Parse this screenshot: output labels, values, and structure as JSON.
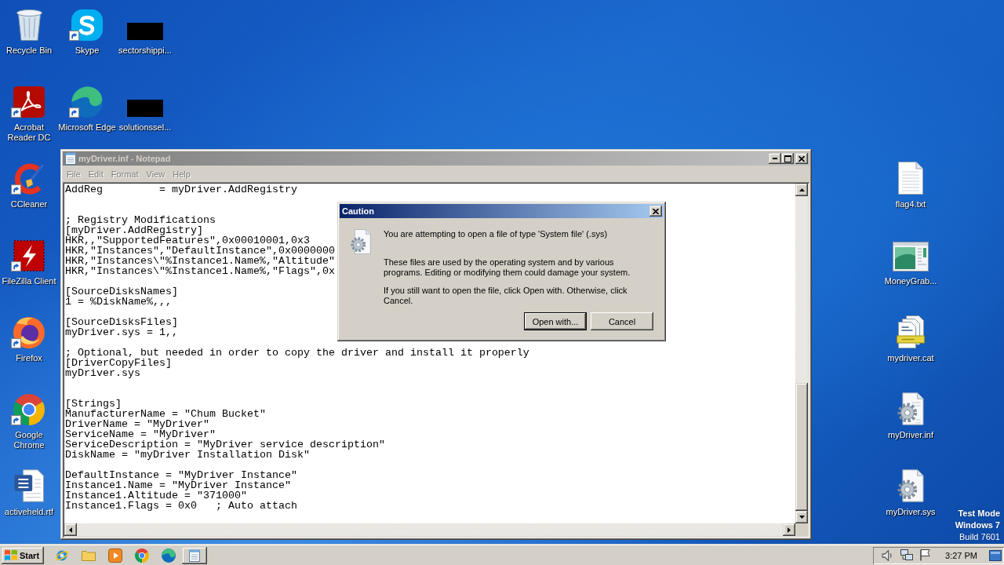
{
  "desktop": {
    "icon_columns": [
      {
        "icons": [
          {
            "label": "Recycle Bin",
            "kind": "recycle_bin",
            "shortcut": false
          },
          {
            "label": "Acrobat Reader DC",
            "kind": "acrobat",
            "shortcut": true
          },
          {
            "label": "CCleaner",
            "kind": "ccleaner",
            "shortcut": true
          },
          {
            "label": "FileZilla Client",
            "kind": "filezilla",
            "shortcut": true
          },
          {
            "label": "Firefox",
            "kind": "firefox",
            "shortcut": true
          },
          {
            "label": "Google Chrome",
            "kind": "chrome",
            "shortcut": true
          },
          {
            "label": "activeheld.rtf",
            "kind": "word_doc",
            "shortcut": false
          }
        ]
      },
      {
        "icons": [
          {
            "label": "Skype",
            "kind": "skype",
            "shortcut": true
          },
          {
            "label": "Microsoft Edge",
            "kind": "edge",
            "shortcut": true
          }
        ]
      },
      {
        "icons": [
          {
            "label": "sectorshippi...",
            "kind": "redacted",
            "shortcut": false
          },
          {
            "label": "solutionssel...",
            "kind": "redacted",
            "shortcut": false
          }
        ]
      }
    ],
    "right_icons": [
      {
        "label": "flag4.txt",
        "kind": "text_file",
        "shortcut": false
      },
      {
        "label": "MoneyGrab...",
        "kind": "app_window",
        "shortcut": false
      },
      {
        "label": "mydriver.cat",
        "kind": "catalog",
        "shortcut": false
      },
      {
        "label": "myDriver.inf",
        "kind": "setup_info",
        "shortcut": false
      },
      {
        "label": "myDriver.sys",
        "kind": "system_file",
        "shortcut": false
      }
    ],
    "test_mode_notice": [
      {
        "text": "Test Mode",
        "bold": true
      },
      {
        "text": "Windows 7",
        "bold": true
      },
      {
        "text": "Build 7601",
        "bold": false
      }
    ]
  },
  "notepad": {
    "title": "myDriver.inf - Notepad",
    "active": false,
    "menu": [
      {
        "label": "File",
        "disabled": true
      },
      {
        "label": "Edit",
        "disabled": true
      },
      {
        "label": "Format",
        "disabled": true
      },
      {
        "label": "View",
        "disabled": true
      },
      {
        "label": "Help",
        "disabled": true
      }
    ],
    "lines": [
      {
        "kind": "code",
        "text": "AddReg         = myDriver.AddRegistry"
      },
      {
        "kind": "blank"
      },
      {
        "kind": "blank"
      },
      {
        "kind": "code",
        "text": "; Registry Modifications"
      },
      {
        "kind": "code",
        "text": "[myDriver.AddRegistry]"
      },
      {
        "kind": "code",
        "text": "HKR,,\"SupportedFeatures\",0x00010001,0x3"
      },
      {
        "kind": "code",
        "text": "HKR,\"Instances\",\"DefaultInstance\",0x0000000"
      },
      {
        "kind": "code",
        "text": "HKR,\"Instances\\\"%Instance1.Name%,\"Altitude\""
      },
      {
        "kind": "code",
        "text": "HKR,\"Instances\\\"%Instance1.Name%,\"Flags\",0x"
      },
      {
        "kind": "blank"
      },
      {
        "kind": "code",
        "text": "[SourceDisksNames]"
      },
      {
        "kind": "code",
        "text": "1 = %DiskName%,,,"
      },
      {
        "kind": "blank"
      },
      {
        "kind": "code",
        "text": "[SourceDisksFiles]"
      },
      {
        "kind": "code",
        "text": "myDriver.sys = 1,,"
      },
      {
        "kind": "blank"
      },
      {
        "kind": "code",
        "text": "; Optional, but needed in order to copy the driver and install it properly"
      },
      {
        "kind": "code",
        "text": "[DriverCopyFiles]"
      },
      {
        "kind": "code",
        "text": "myDriver.sys"
      },
      {
        "kind": "blank"
      },
      {
        "kind": "blank"
      },
      {
        "kind": "code",
        "text": "[Strings]"
      },
      {
        "kind": "code",
        "text": "ManufacturerName = \"Chum Bucket\""
      },
      {
        "kind": "code",
        "text": "DriverName = \"MyDriver\""
      },
      {
        "kind": "code",
        "text": "ServiceName = \"MyDriver\""
      },
      {
        "kind": "code",
        "text": "ServiceDescription = \"MyDriver service description\""
      },
      {
        "kind": "code",
        "text": "DiskName = \"myDriver Installation Disk\""
      },
      {
        "kind": "blank"
      },
      {
        "kind": "code",
        "text": "DefaultInstance = \"MyDriver Instance\""
      },
      {
        "kind": "code",
        "text": "Instance1.Name = \"MyDriver Instance\""
      },
      {
        "kind": "code",
        "text": "Instance1.Altitude = \"371000\""
      },
      {
        "kind": "code",
        "text": "Instance1.Flags = 0x0   ; Auto attach"
      }
    ]
  },
  "dialog": {
    "title": "Caution",
    "active": true,
    "paragraphs": [
      "You are attempting to open a file of type 'System file' (.sys)",
      "These files are used by the operating system and by various programs. Editing or modifying them could damage your system.",
      "If you still want to open the file, click Open with. Otherwise, click Cancel."
    ],
    "buttons": [
      {
        "label": "Open with...",
        "default": true
      },
      {
        "label": "Cancel",
        "default": false
      }
    ]
  },
  "taskbar": {
    "start_label": "Start",
    "quick_launch": [
      {
        "kind": "globe_orbit"
      },
      {
        "kind": "folder"
      },
      {
        "kind": "media_player"
      },
      {
        "kind": "chrome"
      },
      {
        "kind": "edge"
      }
    ],
    "tasks": [
      {
        "kind": "notepad",
        "pressed": false
      }
    ],
    "tray_icons": [
      {
        "kind": "speaker"
      },
      {
        "kind": "network"
      },
      {
        "kind": "flag"
      }
    ],
    "clock": "3:27 PM"
  }
}
